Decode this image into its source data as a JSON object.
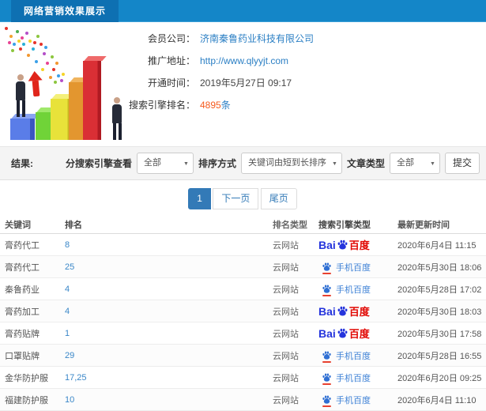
{
  "header": {
    "title": "网络营销效果展示"
  },
  "profile": {
    "rows": [
      {
        "label": "会员公司：",
        "value": "济南秦鲁药业科技有限公司"
      },
      {
        "label": "推广地址：",
        "value": "http://www.qlyyjt.com"
      },
      {
        "label": "开通时间：",
        "value": "2019年5月27日 09:17"
      },
      {
        "label": "搜索引擎排名：",
        "value": "4895",
        "unit": "条"
      }
    ]
  },
  "filters": {
    "result_label": "结果:",
    "engine_label": "分搜索引擎查看",
    "engine_value": "全部",
    "sort_label": "排序方式",
    "sort_value": "关键词由短到长排序",
    "article_label": "文章类型",
    "article_value": "全部",
    "submit_label": "提交"
  },
  "pagination": {
    "current": "1",
    "next_label": "下一页",
    "last_label": "尾页"
  },
  "engine_logo": {
    "bai": "Bai",
    "du": "百度"
  },
  "table": {
    "headers": [
      "关键词",
      "排名",
      "排名类型",
      "搜索引擎类型",
      "最新更新时间"
    ],
    "rows": [
      {
        "keyword": "膏药代工",
        "rank": "8",
        "rank_type": "云网站",
        "engine": "百度",
        "engine_kind": "baidu-pc",
        "updated": "2020年6月4日 11:15"
      },
      {
        "keyword": "膏药代工",
        "rank": "25",
        "rank_type": "云网站",
        "engine": "手机百度",
        "engine_kind": "baidu-mobile",
        "updated": "2020年5月30日 18:06"
      },
      {
        "keyword": "秦鲁药业",
        "rank": "4",
        "rank_type": "云网站",
        "engine": "手机百度",
        "engine_kind": "baidu-mobile",
        "updated": "2020年5月28日 17:02"
      },
      {
        "keyword": "膏药加工",
        "rank": "4",
        "rank_type": "云网站",
        "engine": "百度",
        "engine_kind": "baidu-pc",
        "updated": "2020年5月30日 18:03"
      },
      {
        "keyword": "膏药贴牌",
        "rank": "1",
        "rank_type": "云网站",
        "engine": "百度",
        "engine_kind": "baidu-pc",
        "updated": "2020年5月30日 17:58"
      },
      {
        "keyword": "口罩贴牌",
        "rank": "29",
        "rank_type": "云网站",
        "engine": "手机百度",
        "engine_kind": "baidu-mobile",
        "updated": "2020年5月28日 16:55"
      },
      {
        "keyword": "金华防护服",
        "rank": "17,25",
        "rank_type": "云网站",
        "engine": "手机百度",
        "engine_kind": "baidu-mobile",
        "updated": "2020年6月20日 09:25"
      },
      {
        "keyword": "福建防护服",
        "rank": "10",
        "rank_type": "云网站",
        "engine": "手机百度",
        "engine_kind": "baidu-mobile",
        "updated": "2020年6月4日 11:10"
      }
    ]
  }
}
